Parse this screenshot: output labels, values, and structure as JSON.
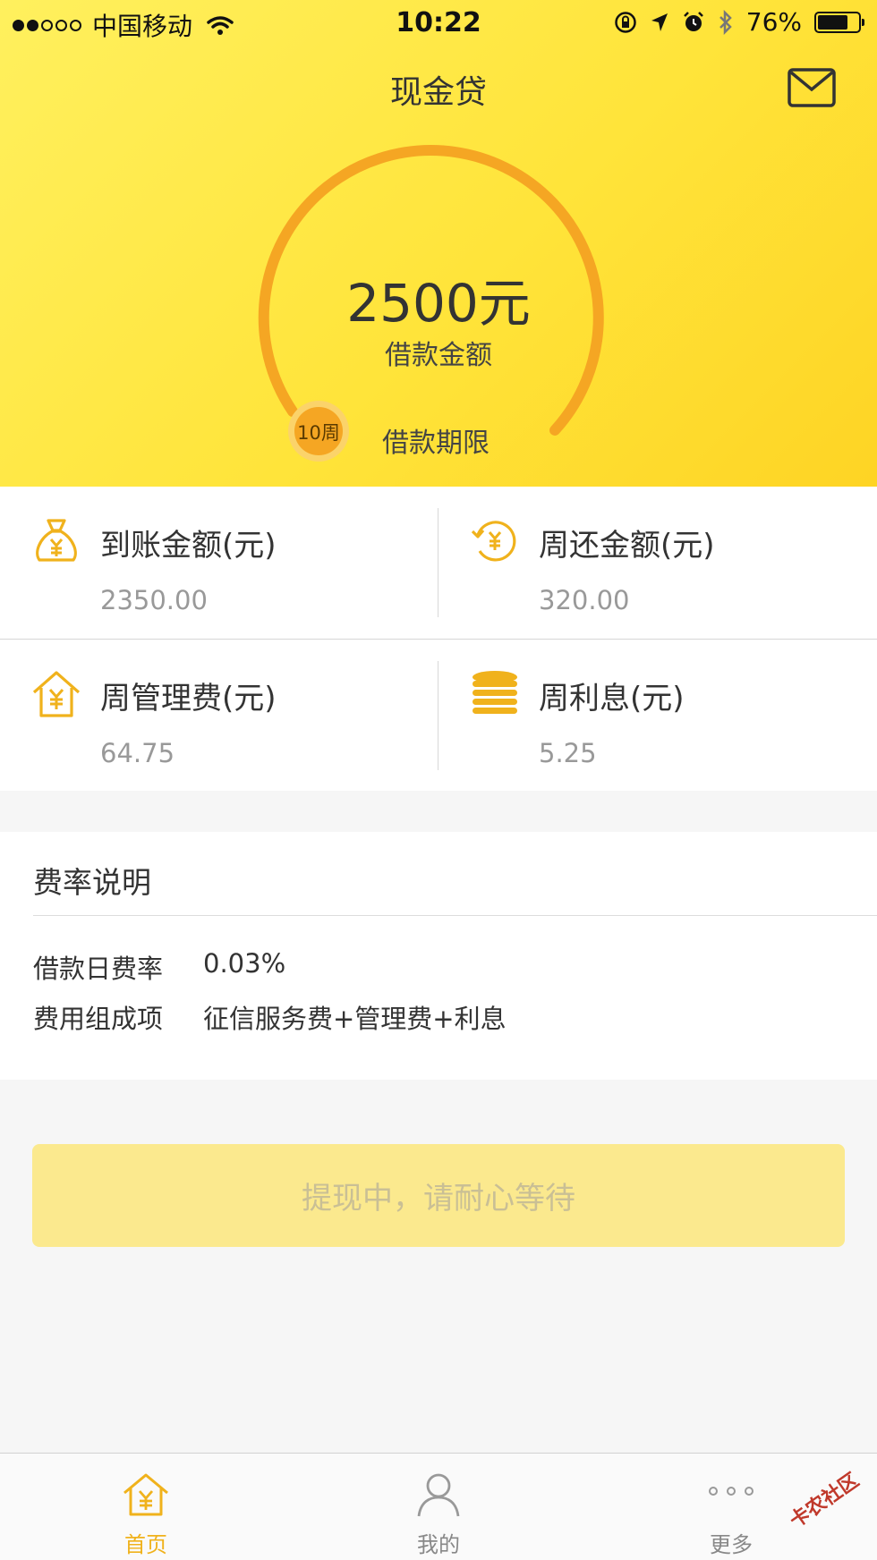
{
  "status_bar": {
    "carrier": "中国移动",
    "time": "10:22",
    "battery_percent": "76%",
    "battery_level": 0.76
  },
  "header": {
    "title": "现金贷",
    "mail_icon": "mail-icon"
  },
  "loan": {
    "amount": "2500元",
    "amount_label": "借款金额",
    "period_value": "10周",
    "period_label": "借款期限"
  },
  "info": [
    {
      "label": "到账金额(元)",
      "value": "2350.00",
      "icon": "money-bag-icon"
    },
    {
      "label": "周还金额(元)",
      "value": "320.00",
      "icon": "repay-cycle-icon"
    },
    {
      "label": "周管理费(元)",
      "value": "64.75",
      "icon": "house-yen-icon"
    },
    {
      "label": "周利息(元)",
      "value": "5.25",
      "icon": "coin-stack-icon"
    }
  ],
  "rate": {
    "title": "费率说明",
    "rows": [
      {
        "key": "借款日费率",
        "value": "0.03%"
      },
      {
        "key": "费用组成项",
        "value": "征信服务费+管理费+利息"
      }
    ]
  },
  "action_button": "提现中，请耐心等待",
  "tabs": [
    {
      "label": "首页",
      "icon": "home-yen-icon",
      "active": true
    },
    {
      "label": "我的",
      "icon": "person-icon",
      "active": false
    },
    {
      "label": "更多",
      "icon": "more-dots-icon",
      "active": false
    }
  ],
  "watermark": "卡农社区",
  "colors": {
    "accent": "#f5a623",
    "header_yellow": "#ffe43a",
    "button_disabled": "#fbe98e",
    "tab_active": "#f0b21c"
  }
}
